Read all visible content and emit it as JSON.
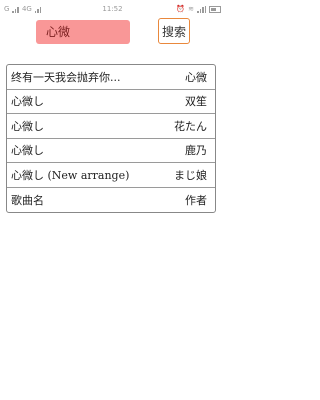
{
  "status_bar": {
    "left_text": "G",
    "network": "4G",
    "center_text": "11:52",
    "right_icons": [
      "alarm-icon",
      "wifi-icon",
      "signal-icon",
      "battery-icon"
    ]
  },
  "search": {
    "input_value": "心微",
    "button_label": "搜索"
  },
  "results": [
    {
      "song": "终有一天我会抛弃你...",
      "artist": "心微"
    },
    {
      "song": "心微し",
      "artist": "双笙"
    },
    {
      "song": "心微し",
      "artist": "花たん"
    },
    {
      "song": "心微し",
      "artist": "鹿乃"
    },
    {
      "song": "心微し (New arrange)",
      "artist": "まじ娘"
    },
    {
      "song": "歌曲名",
      "artist": "作者"
    }
  ],
  "colors": {
    "input_bg": "#f99797",
    "button_border": "#e9883c"
  }
}
